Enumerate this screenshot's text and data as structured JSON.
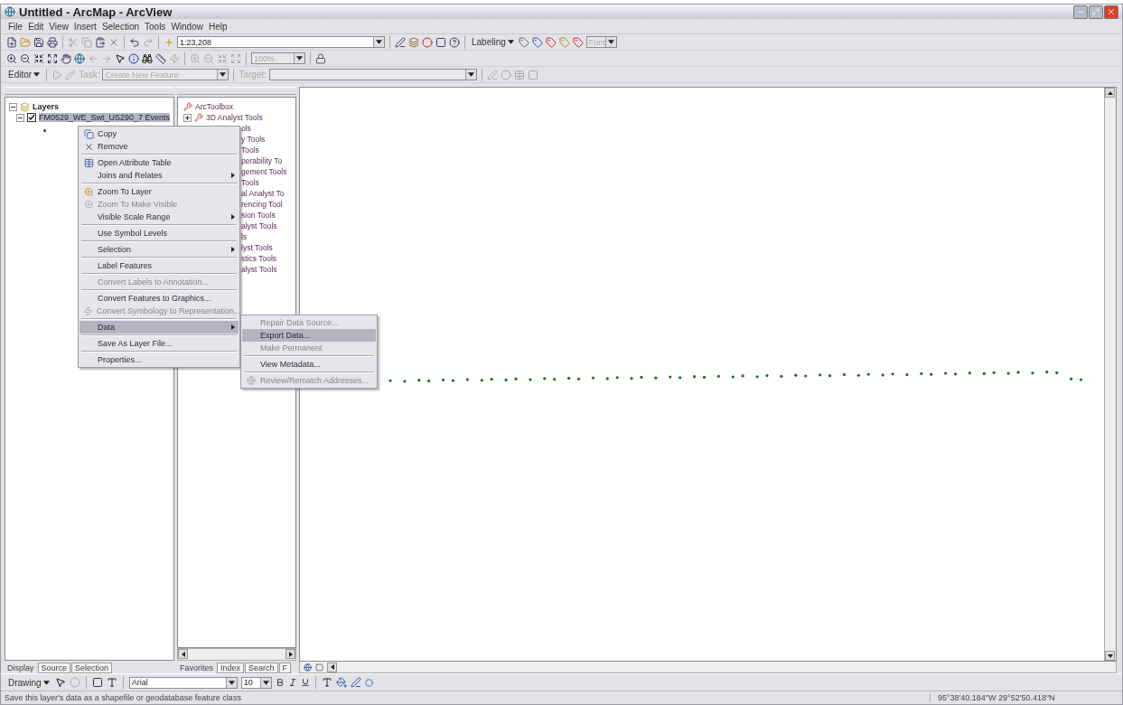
{
  "window": {
    "title": "Untitled - ArcMap - ArcView"
  },
  "menu_bar": [
    "File",
    "Edit",
    "View",
    "Insert",
    "Selection",
    "Tools",
    "Window",
    "Help"
  ],
  "standard_toolbar": {
    "scale": "1:23,208"
  },
  "labeling_toolbar": {
    "label": "Labeling",
    "font": {
      "value": "Font",
      "disabled": true
    }
  },
  "tools_toolbar": {
    "zoom": {
      "value": "100%",
      "disabled": true
    }
  },
  "editor_toolbar": {
    "label": "Editor",
    "task_label": "Task:",
    "task": "Create New Feature",
    "target_label": "Target:",
    "disabled": true
  },
  "table_of_contents": {
    "root": {
      "label": "Layers",
      "expanded": true,
      "children": [
        {
          "label": "FM0529_WE_Swt_US290_7 Events",
          "checked": true,
          "selected": true,
          "expanded": true
        }
      ]
    },
    "tabs": [
      {
        "label": "Display",
        "selected": true
      },
      {
        "label": "Source",
        "selected": false
      },
      {
        "label": "Selection",
        "selected": false
      }
    ]
  },
  "toolbox": {
    "items": [
      {
        "label": "ArcToolbox",
        "kind": "root"
      },
      {
        "label": "3D Analyst Tools",
        "kind": "toolset"
      },
      {
        "label": "ols",
        "kind": "fragment"
      },
      {
        "label": "y Tools",
        "kind": "fragment"
      },
      {
        "label": "Tools",
        "kind": "fragment"
      },
      {
        "label": "perability To",
        "kind": "fragment"
      },
      {
        "label": "gement Tools",
        "kind": "fragment"
      },
      {
        "label": "Tools",
        "kind": "fragment"
      },
      {
        "label": "al Analyst To",
        "kind": "fragment"
      },
      {
        "label": "rencing Tool",
        "kind": "fragment"
      },
      {
        "label": "sion Tools",
        "kind": "fragment"
      },
      {
        "label": "alyst Tools",
        "kind": "fragment"
      },
      {
        "label": "ls",
        "kind": "fragment"
      },
      {
        "label": "lyst Tools",
        "kind": "fragment"
      },
      {
        "label": "stics Tools",
        "kind": "fragment"
      },
      {
        "label": "alyst Tools",
        "kind": "fragment"
      }
    ],
    "tabs": [
      {
        "label": "Favorites",
        "selected": true
      },
      {
        "label": "Index",
        "selected": false
      },
      {
        "label": "Search",
        "selected": false
      },
      {
        "label": "F",
        "selected": false
      }
    ]
  },
  "context_menu": {
    "groups": [
      [
        {
          "label": "Copy",
          "disabled": false,
          "submenu": false,
          "selected": false
        },
        {
          "label": "Remove",
          "disabled": false,
          "submenu": false,
          "selected": false
        }
      ],
      [
        {
          "label": "Open Attribute Table",
          "disabled": false,
          "submenu": false,
          "selected": false
        },
        {
          "label": "Joins and Relates",
          "disabled": false,
          "submenu": true,
          "selected": false
        }
      ],
      [
        {
          "label": "Zoom To Layer",
          "disabled": false,
          "submenu": false,
          "selected": false
        },
        {
          "label": "Zoom To Make Visible",
          "disabled": true,
          "submenu": false,
          "selected": false
        },
        {
          "label": "Visible Scale Range",
          "disabled": false,
          "submenu": true,
          "selected": false
        }
      ],
      [
        {
          "label": "Use Symbol Levels",
          "disabled": false,
          "submenu": false,
          "selected": false
        }
      ],
      [
        {
          "label": "Selection",
          "disabled": false,
          "submenu": true,
          "selected": false
        }
      ],
      [
        {
          "label": "Label Features",
          "disabled": false,
          "submenu": false,
          "selected": false
        }
      ],
      [
        {
          "label": "Convert Labels to Annotation...",
          "disabled": true,
          "submenu": false,
          "selected": false
        }
      ],
      [
        {
          "label": "Convert Features to Graphics...",
          "disabled": false,
          "submenu": false,
          "selected": false
        },
        {
          "label": "Convert Symbology to Representation...",
          "disabled": true,
          "submenu": false,
          "selected": false
        }
      ],
      [
        {
          "label": "Data",
          "disabled": false,
          "submenu": true,
          "selected": true
        }
      ],
      [
        {
          "label": "Save As Layer File...",
          "disabled": false,
          "submenu": false,
          "selected": false
        }
      ],
      [
        {
          "label": "Properties...",
          "disabled": false,
          "submenu": false,
          "selected": false
        }
      ]
    ]
  },
  "data_submenu": {
    "groups": [
      [
        {
          "label": "Repair Data Source...",
          "disabled": true,
          "selected": false
        },
        {
          "label": "Export Data...",
          "disabled": false,
          "selected": true
        },
        {
          "label": "Make Permanent",
          "disabled": true,
          "selected": false
        }
      ],
      [
        {
          "label": "View Metadata...",
          "disabled": false,
          "selected": false
        }
      ],
      [
        {
          "label": "Review/Rematch Addresses...",
          "disabled": true,
          "selected": false
        }
      ]
    ]
  },
  "drawing_toolbar": {
    "label": "Drawing",
    "font": "Arial",
    "size": "10"
  },
  "status_bar": {
    "message": "Save this layer's data as a shapefile or geodatabase feature class",
    "coordinates": "95°38'40.184\"W  29°52'50.418\"N"
  }
}
